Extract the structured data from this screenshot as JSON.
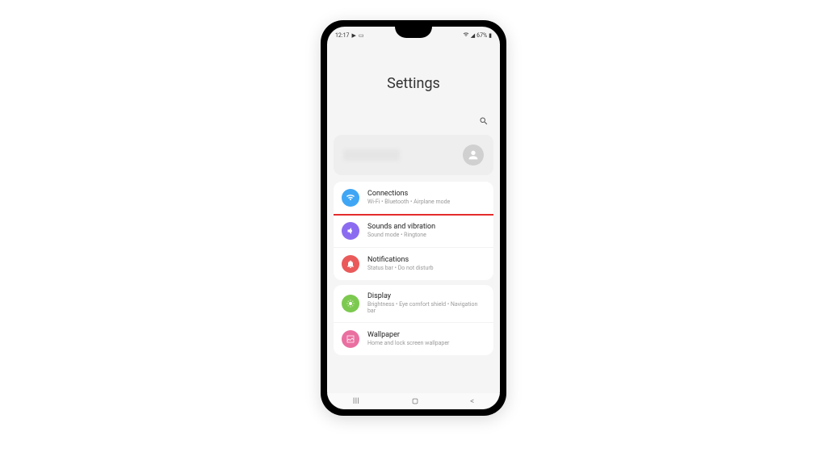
{
  "status": {
    "time": "12:17",
    "battery": "67%"
  },
  "header": {
    "title": "Settings"
  },
  "items": {
    "connections": {
      "title": "Connections",
      "sub": "Wi-Fi • Bluetooth • Airplane mode"
    },
    "sounds": {
      "title": "Sounds and vibration",
      "sub": "Sound mode • Ringtone"
    },
    "notifications": {
      "title": "Notifications",
      "sub": "Status bar • Do not disturb"
    },
    "display": {
      "title": "Display",
      "sub": "Brightness • Eye comfort shield • Navigation bar"
    },
    "wallpaper": {
      "title": "Wallpaper",
      "sub": "Home and lock screen wallpaper"
    }
  }
}
